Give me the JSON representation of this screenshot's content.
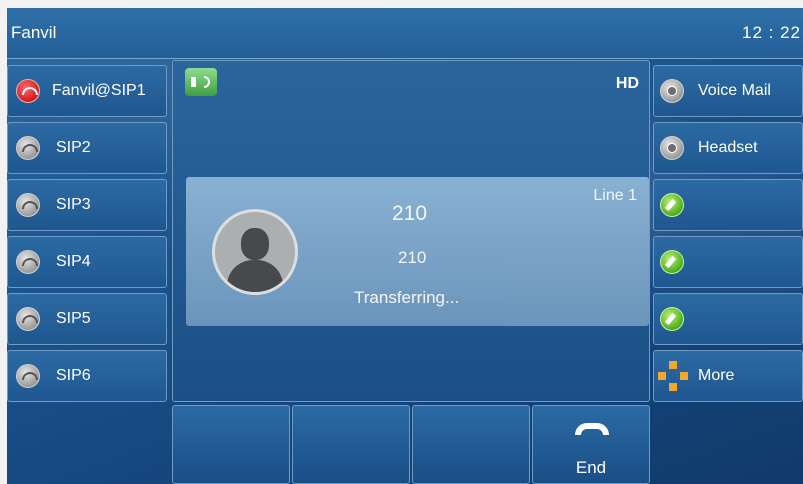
{
  "status_bar": {
    "brand": "Fanvil",
    "time": "12 : 22"
  },
  "left_keys": [
    {
      "label": "Fanvil@SIP1",
      "icon": "handset-red-icon",
      "active": true
    },
    {
      "label": "SIP2",
      "icon": "handset-icon"
    },
    {
      "label": "SIP3",
      "icon": "handset-icon"
    },
    {
      "label": "SIP4",
      "icon": "handset-icon"
    },
    {
      "label": "SIP5",
      "icon": "handset-icon"
    },
    {
      "label": "SIP6",
      "icon": "handset-icon"
    }
  ],
  "right_keys": [
    {
      "label": "Voice Mail",
      "icon": "radio-icon"
    },
    {
      "label": "Headset",
      "icon": "radio-icon"
    },
    {
      "label": "",
      "icon": "pencil-icon"
    },
    {
      "label": "",
      "icon": "pencil-icon"
    },
    {
      "label": "",
      "icon": "pencil-icon"
    },
    {
      "label": "More",
      "icon": "arrows-icon"
    }
  ],
  "call": {
    "audio_icon": "speaker-icon",
    "quality": "HD",
    "line": "Line 1",
    "name": "210",
    "number": "210",
    "status": "Transferring..."
  },
  "softkeys": [
    "",
    "",
    "",
    "End"
  ],
  "colors": {
    "background": "#1f5590",
    "active_line": "#d11a1a",
    "edit_key": "#4cae1a",
    "more_arrows": "#f0a830"
  }
}
